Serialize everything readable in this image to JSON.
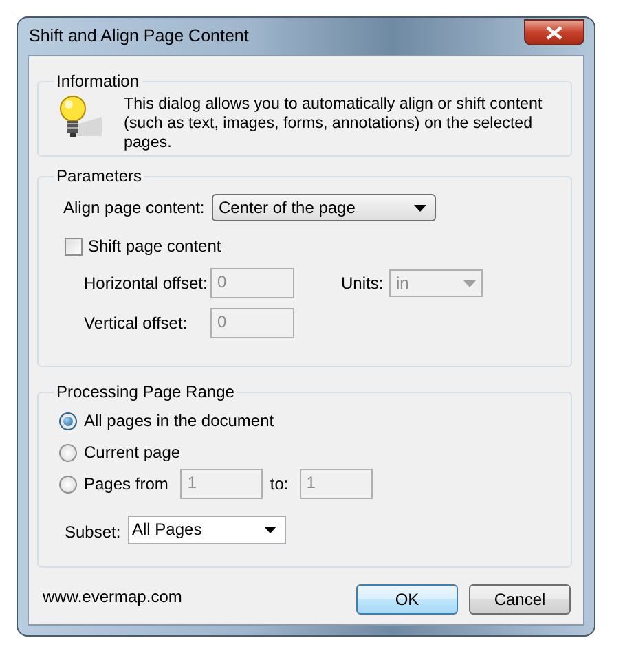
{
  "window": {
    "title": "Shift and Align Page Content"
  },
  "information": {
    "legend": "Information",
    "text": "This dialog allows you to automatically align or shift content (such as text, images, forms, annotations) on the selected pages."
  },
  "parameters": {
    "legend": "Parameters",
    "align_label": "Align page content:",
    "align_value": "Center of the page",
    "shift": {
      "label": "Shift page content",
      "checked": false
    },
    "horizontal_label": "Horizontal offset:",
    "horizontal_value": "0",
    "units_label": "Units:",
    "units_value": "in",
    "vertical_label": "Vertical offset:",
    "vertical_value": "0",
    "offsets_disabled": true
  },
  "page_range": {
    "legend": "Processing Page Range",
    "options": [
      {
        "label": "All pages in the document",
        "selected": true
      },
      {
        "label": "Current page",
        "selected": false
      },
      {
        "label": "Pages from",
        "selected": false
      }
    ],
    "from_value": "1",
    "to_label": "to:",
    "to_value": "1",
    "subset_label": "Subset:",
    "subset_value": "All Pages"
  },
  "footer": {
    "link": "www.evermap.com",
    "buttons": [
      {
        "label": "OK",
        "default": true
      },
      {
        "label": "Cancel",
        "default": false
      }
    ]
  }
}
